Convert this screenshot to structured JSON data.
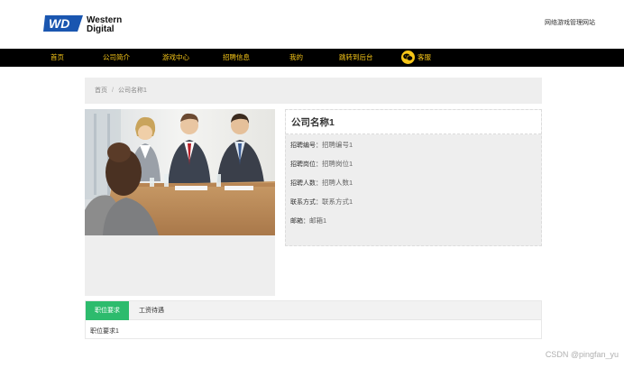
{
  "header": {
    "logo_text_line1": "Western",
    "logo_text_line2": "Digital",
    "logo_mark": "WD",
    "site_title": "网络游戏管理网站"
  },
  "nav": {
    "items": [
      {
        "label": "首页"
      },
      {
        "label": "公司简介"
      },
      {
        "label": "游戏中心"
      },
      {
        "label": "招聘信息"
      },
      {
        "label": "我的"
      },
      {
        "label": "跳转到后台"
      },
      {
        "label": "客服",
        "icon": "wechat-icon"
      }
    ],
    "text_color": "#f5c518",
    "background": "#000000"
  },
  "breadcrumb": {
    "home": "首页",
    "separator": "/",
    "current": "公司名称1"
  },
  "details": {
    "title": "公司名称1",
    "rows": [
      {
        "label": "招聘编号：",
        "value": "招聘编号1"
      },
      {
        "label": "招聘岗位：",
        "value": "招聘岗位1"
      },
      {
        "label": "招聘人数：",
        "value": "招聘人数1"
      },
      {
        "label": "联系方式：",
        "value": "联系方式1"
      },
      {
        "label": "邮箱：",
        "value": "邮箱1"
      }
    ]
  },
  "tabs": {
    "items": [
      {
        "label": "职位要求",
        "active": true
      },
      {
        "label": "工资待遇",
        "active": false
      }
    ],
    "content": "职位要求1",
    "active_color": "#2dbb6d"
  },
  "watermark": "CSDN @pingfan_yu"
}
